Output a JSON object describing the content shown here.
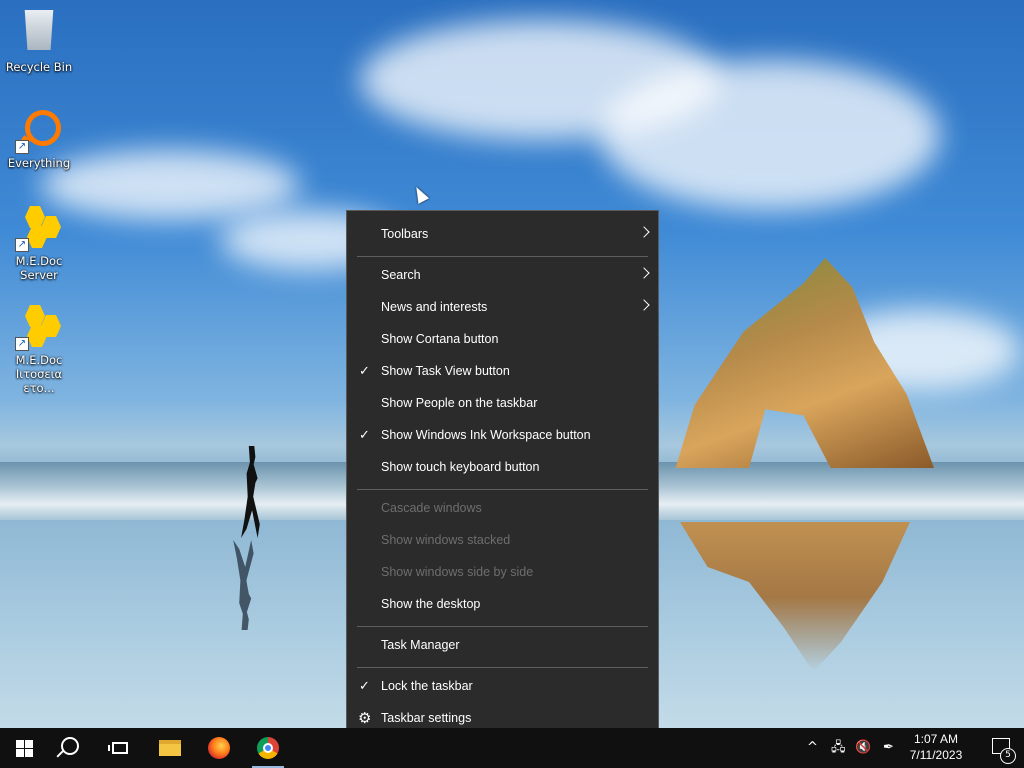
{
  "desktop": {
    "icons": [
      {
        "label": "Recycle Bin",
        "icon": "recycle-bin-icon"
      },
      {
        "label": "Everything",
        "icon": "everything-search-icon"
      },
      {
        "label": "M.E.Doc Server",
        "line1": "M.E.Doc",
        "line2": "Server",
        "icon": "medoc-icon"
      },
      {
        "label": "M.E.Doc Ιιτοσεια ετο...",
        "line1": "M.E.Doc",
        "line2": "Ιιτοσεια ετο...",
        "icon": "medoc-icon"
      }
    ]
  },
  "context_menu": {
    "items": [
      {
        "label": "Toolbars",
        "submenu": true,
        "checked": false,
        "enabled": true
      },
      {
        "label": "Search",
        "submenu": true,
        "checked": false,
        "enabled": true
      },
      {
        "label": "News and interests",
        "submenu": true,
        "checked": false,
        "enabled": true
      },
      {
        "label": "Show Cortana button",
        "submenu": false,
        "checked": false,
        "enabled": true
      },
      {
        "label": "Show Task View button",
        "submenu": false,
        "checked": true,
        "enabled": true
      },
      {
        "label": "Show People on the taskbar",
        "submenu": false,
        "checked": false,
        "enabled": true
      },
      {
        "label": "Show Windows Ink Workspace button",
        "submenu": false,
        "checked": true,
        "enabled": true
      },
      {
        "label": "Show touch keyboard button",
        "submenu": false,
        "checked": false,
        "enabled": true
      },
      {
        "label": "Cascade windows",
        "submenu": false,
        "checked": false,
        "enabled": false
      },
      {
        "label": "Show windows stacked",
        "submenu": false,
        "checked": false,
        "enabled": false
      },
      {
        "label": "Show windows side by side",
        "submenu": false,
        "checked": false,
        "enabled": false
      },
      {
        "label": "Show the desktop",
        "submenu": false,
        "checked": false,
        "enabled": true
      },
      {
        "label": "Task Manager",
        "submenu": false,
        "checked": false,
        "enabled": true
      },
      {
        "label": "Lock the taskbar",
        "submenu": false,
        "checked": true,
        "enabled": true
      },
      {
        "label": "Taskbar settings",
        "submenu": false,
        "checked": false,
        "enabled": true,
        "icon": "gear-icon"
      }
    ],
    "check_glyph": "✓"
  },
  "taskbar": {
    "buttons": [
      {
        "name": "start",
        "icon": "windows-logo-icon"
      },
      {
        "name": "search",
        "icon": "search-icon"
      },
      {
        "name": "task-view",
        "icon": "task-view-icon"
      },
      {
        "name": "file-explorer",
        "icon": "folder-icon"
      },
      {
        "name": "firefox",
        "icon": "firefox-icon"
      },
      {
        "name": "chrome",
        "icon": "chrome-icon",
        "active": true
      }
    ],
    "tray": {
      "chevron": "^",
      "network_icon": "network-icon",
      "volume_icon": "volume-muted-icon",
      "pen_icon": "pen-icon"
    },
    "clock": {
      "time": "1:07 AM",
      "date": "7/11/2023"
    },
    "notifications": {
      "count": "5",
      "icon": "notification-center-icon"
    }
  },
  "colors": {
    "menu_bg": "#2b2b2b",
    "menu_text": "#ffffff",
    "menu_disabled_text": "#6e6e6e",
    "taskbar_bg": "#101010"
  }
}
